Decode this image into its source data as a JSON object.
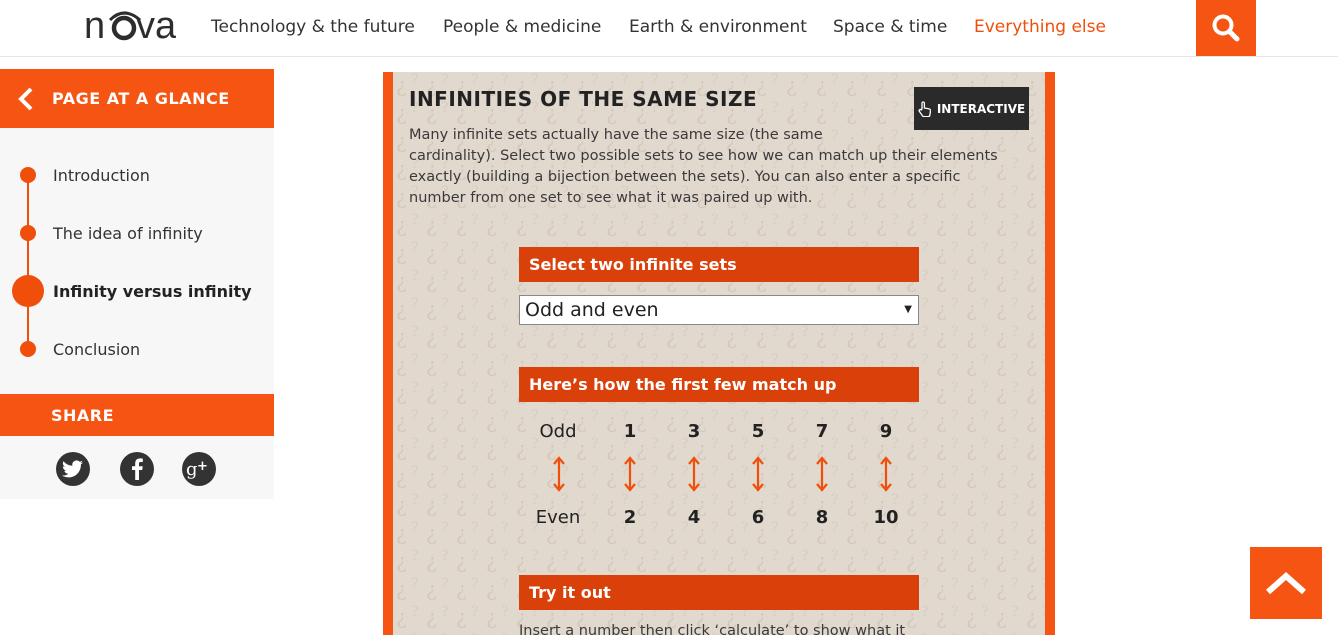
{
  "header": {
    "logo_text": "nova",
    "nav": [
      {
        "label": "Technology & the future"
      },
      {
        "label": "People & medicine"
      },
      {
        "label": "Earth & environment"
      },
      {
        "label": "Space & time"
      },
      {
        "label": "Everything else",
        "active": true
      }
    ],
    "search_icon": "search-icon"
  },
  "sidebar": {
    "title": "PAGE AT A GLANCE",
    "items": [
      {
        "label": "Introduction"
      },
      {
        "label": "The idea of infinity"
      },
      {
        "label": "Infinity versus infinity",
        "current": true
      },
      {
        "label": "Conclusion"
      }
    ],
    "share_title": "SHARE",
    "share_icons": [
      "twitter-icon",
      "facebook-icon",
      "google-plus-icon"
    ]
  },
  "main": {
    "title": "INFINITIES OF THE SAME SIZE",
    "badge": "INTERACTIVE",
    "intro_lines": [
      "Many infinite sets actually have the same size (the same",
      "cardinality). Select two possible sets to see how we can match up their elements",
      "exactly (building a bijection between the sets). You can also enter a specific",
      "number from one set to see what it was paired up with."
    ],
    "select_heading": "Select two infinite sets",
    "select_value": "Odd and even",
    "match_heading": "Here’s how the first few match up",
    "set_a_label": "Odd",
    "set_b_label": "Even",
    "set_a_values": [
      "1",
      "3",
      "5",
      "7",
      "9"
    ],
    "set_b_values": [
      "2",
      "4",
      "6",
      "8",
      "10"
    ],
    "try_heading": "Try it out",
    "try_text": "Insert a number then click ‘calculate’ to show what it"
  },
  "colors": {
    "accent": "#f55412",
    "dark_accent": "#d9400a",
    "card_bg": "#e1d8ce"
  }
}
